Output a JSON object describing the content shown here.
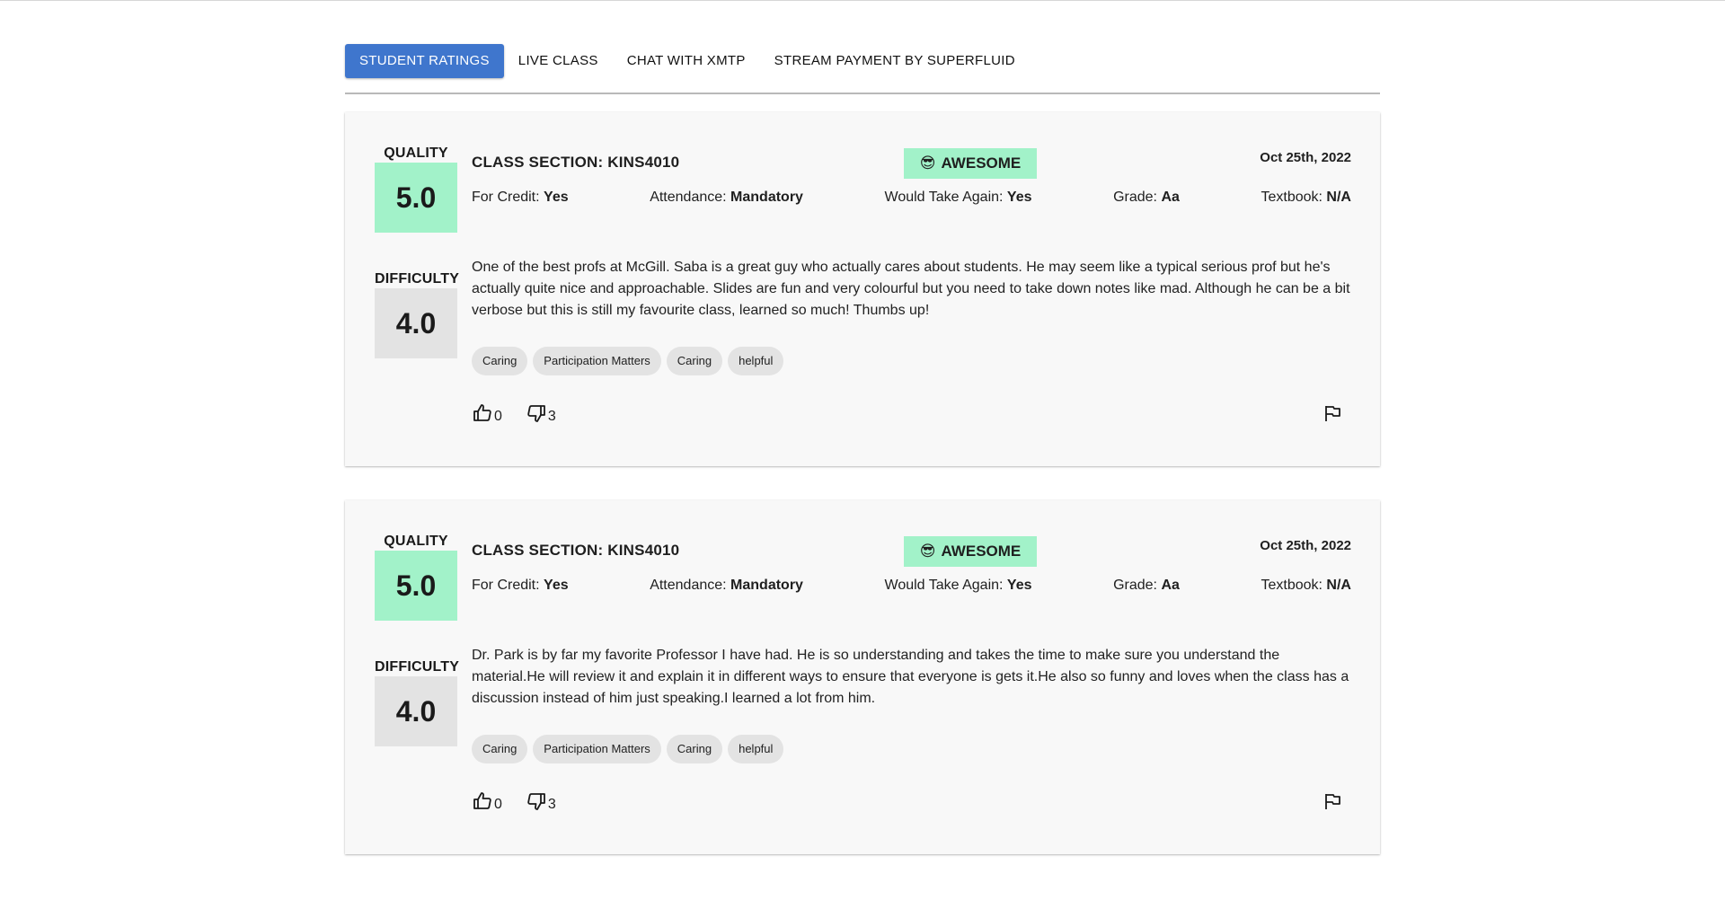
{
  "tabs": [
    {
      "label": "STUDENT RATINGS"
    },
    {
      "label": "LIVE CLASS"
    },
    {
      "label": "CHAT WITH XMTP"
    },
    {
      "label": "STREAM PAYMENT BY SUPERFLUID"
    }
  ],
  "ratings": [
    {
      "quality_label": "QUALITY",
      "quality": "5.0",
      "difficulty_label": "DIFFICULTY",
      "difficulty": "4.0",
      "section": "CLASS SECTION: KINS4010",
      "badge_emoji": "😎",
      "badge": "AWESOME",
      "date": "Oct 25th, 2022",
      "credit_label": "For Credit:",
      "credit": "Yes",
      "attendance_label": "Attendance:",
      "attendance": "Mandatory",
      "again_label": "Would Take Again:",
      "again": "Yes",
      "grade_label": "Grade:",
      "grade": "Aa",
      "textbook_label": "Textbook:",
      "textbook": "N/A",
      "comment": "One of the best profs at McGill. Saba is a great guy who actually cares about students. He may seem like a typical serious prof but he's actually quite nice and approachable. Slides are fun and very colourful but you need to take down notes like mad. Although he can be a bit verbose but this is still my favourite class, learned so much! Thumbs up!",
      "tags": [
        "Caring",
        "Participation Matters",
        "Caring",
        "helpful"
      ],
      "thumbs_up": "0",
      "thumbs_down": "3"
    },
    {
      "quality_label": "QUALITY",
      "quality": "5.0",
      "difficulty_label": "DIFFICULTY",
      "difficulty": "4.0",
      "section": "CLASS SECTION: KINS4010",
      "badge_emoji": "😎",
      "badge": "AWESOME",
      "date": "Oct 25th, 2022",
      "credit_label": "For Credit:",
      "credit": "Yes",
      "attendance_label": "Attendance:",
      "attendance": "Mandatory",
      "again_label": "Would Take Again:",
      "again": "Yes",
      "grade_label": "Grade:",
      "grade": "Aa",
      "textbook_label": "Textbook:",
      "textbook": "N/A",
      "comment": "Dr. Park is by far my favorite Professor I have had. He is so understanding and takes the time to make sure you understand the material.He will review it and explain it in different ways to ensure that everyone is gets it.He also so funny and loves when the class has a discussion instead of him just speaking.I learned a lot from him.",
      "tags": [
        "Caring",
        "Participation Matters",
        "Caring",
        "helpful"
      ],
      "thumbs_up": "0",
      "thumbs_down": "3"
    }
  ],
  "colors": {
    "tab_active": "#3f76cd",
    "quality_bg": "#a2f2c9",
    "difficulty_bg": "#e3e3e3",
    "card_bg": "#f8f8f8"
  }
}
